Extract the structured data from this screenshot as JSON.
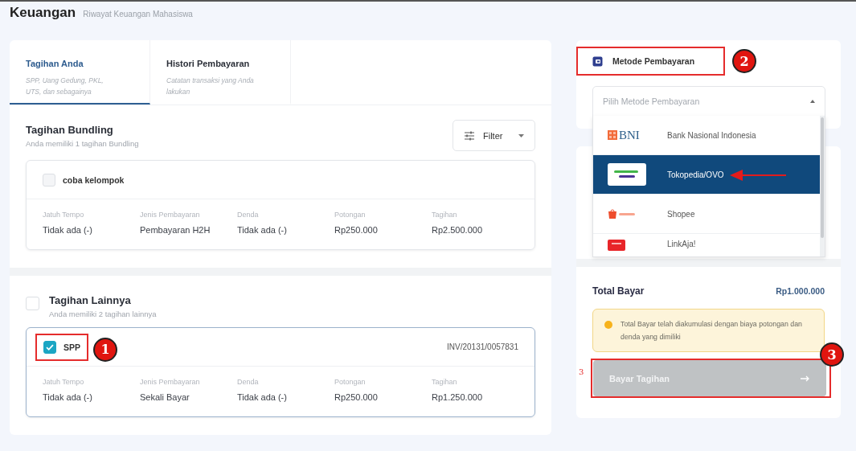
{
  "header": {
    "title": "Keuangan",
    "subtitle": "Riwayat Keuangan Mahasiswa"
  },
  "tabs": [
    {
      "label": "Tagihan Anda",
      "description": "SPP, Uang Gedung, PKL, UTS, dan sebagainya",
      "selected": true
    },
    {
      "label": "Histori Pembayaran",
      "description": "Catatan transaksi yang Anda lakukan",
      "selected": false
    }
  ],
  "sections": [
    {
      "kind": "bundling",
      "title": "Tagihan Bundling",
      "subtitle": "Anda memiliki 1 tagihan Bundling",
      "filter": "Filter",
      "bills": [
        {
          "name": "coba kelompok",
          "checked": false,
          "fields": [
            {
              "label": "Jatuh Tempo",
              "value": "Tidak ada (-)"
            },
            {
              "label": "Jenis Pembayaran",
              "value": "Pembayaran H2H"
            },
            {
              "label": "Denda",
              "value": "Tidak ada (-)"
            },
            {
              "label": "Potongan",
              "value": "Rp250.000"
            },
            {
              "label": "Tagihan",
              "value": "Rp2.500.000"
            }
          ]
        }
      ]
    },
    {
      "kind": "other",
      "title": "Tagihan Lainnya",
      "subtitle": "Anda memiliki 2 tagihan lainnya",
      "checked": false,
      "bills": [
        {
          "name": "SPP",
          "checked": true,
          "invoice": "INV/20131/0057831",
          "annotation": "1",
          "fields": [
            {
              "label": "Jatuh Tempo",
              "value": "Tidak ada (-)"
            },
            {
              "label": "Jenis Pembayaran",
              "value": "Sekali Bayar"
            },
            {
              "label": "Denda",
              "value": "Tidak ada (-)"
            },
            {
              "label": "Potongan",
              "value": "Rp250.000"
            },
            {
              "label": "Tagihan",
              "value": "Rp1.250.000"
            }
          ]
        }
      ]
    }
  ],
  "payment_method": {
    "title": "Metode Pembayaran",
    "annotation": "2",
    "placeholder": "Pilih Metode Pembayaran",
    "expanded": true,
    "options": [
      {
        "name": "Bank Nasional Indonesia",
        "kind": "bni",
        "logo_text": "BNI",
        "selected": false
      },
      {
        "name": "Tokopedia/OVO",
        "kind": "tokopedia_ovo",
        "selected": true,
        "pointer_arrow": true
      },
      {
        "name": "Shopee",
        "kind": "shopee",
        "selected": false
      },
      {
        "name": "LinkAja!",
        "kind": "linkaja",
        "selected": false
      }
    ]
  },
  "summary": {
    "total_label": "Total Bayar",
    "total_value": "Rp1.000.000",
    "note": "Total Bayar telah diakumulasi dengan biaya potongan dan denda yang dimiliki",
    "pay_button": {
      "label": "Bayar Tagihan",
      "disabled": true,
      "annotation": "3",
      "side_label": "3"
    }
  }
}
